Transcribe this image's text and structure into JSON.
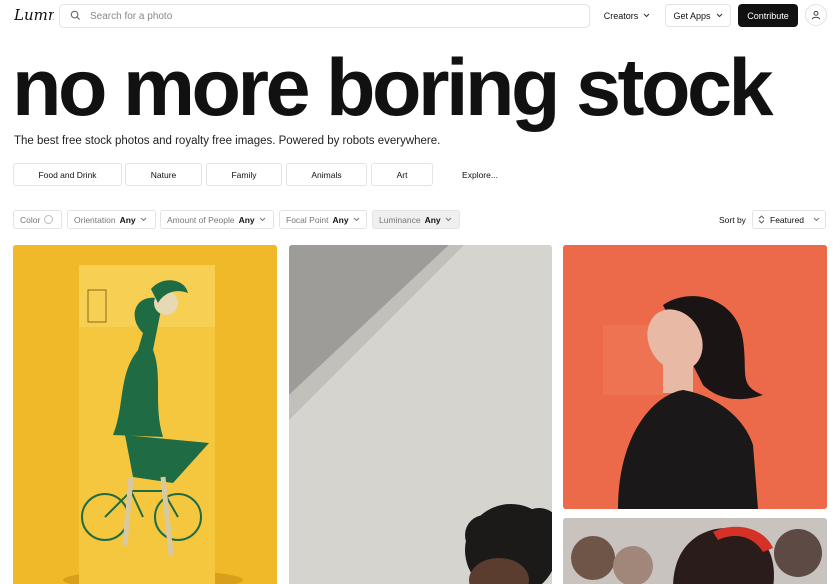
{
  "brand": {
    "logo_text": "Lummi"
  },
  "search": {
    "placeholder": "Search for a photo"
  },
  "nav": {
    "creators": "Creators",
    "get_apps": "Get Apps",
    "contribute": "Contribute"
  },
  "hero": {
    "title": "no more boring stock",
    "subtitle": "The best free stock photos and royalty free images. Powered by robots everywhere."
  },
  "categories": [
    "Food and Drink",
    "Nature",
    "Family",
    "Animals",
    "Art"
  ],
  "explore": "Explore...",
  "filters": {
    "color": "Color",
    "orientation": {
      "label": "Orientation",
      "value": "Any"
    },
    "people": {
      "label": "Amount of People",
      "value": "Any"
    },
    "focal": {
      "label": "Focal Point",
      "value": "Any"
    },
    "luminance": {
      "label": "Luminance",
      "value": "Any"
    }
  },
  "sort": {
    "label": "Sort by",
    "value": "Featured"
  },
  "icons": {
    "search": "search-icon",
    "chevron": "chevron-down-icon",
    "user": "user-icon",
    "sort": "sort-icon"
  },
  "colors": {
    "accent": "#111111",
    "photo_yellow": "#f0b92a",
    "photo_grey": "#d6d4cf",
    "photo_orange": "#ec6a4a"
  }
}
